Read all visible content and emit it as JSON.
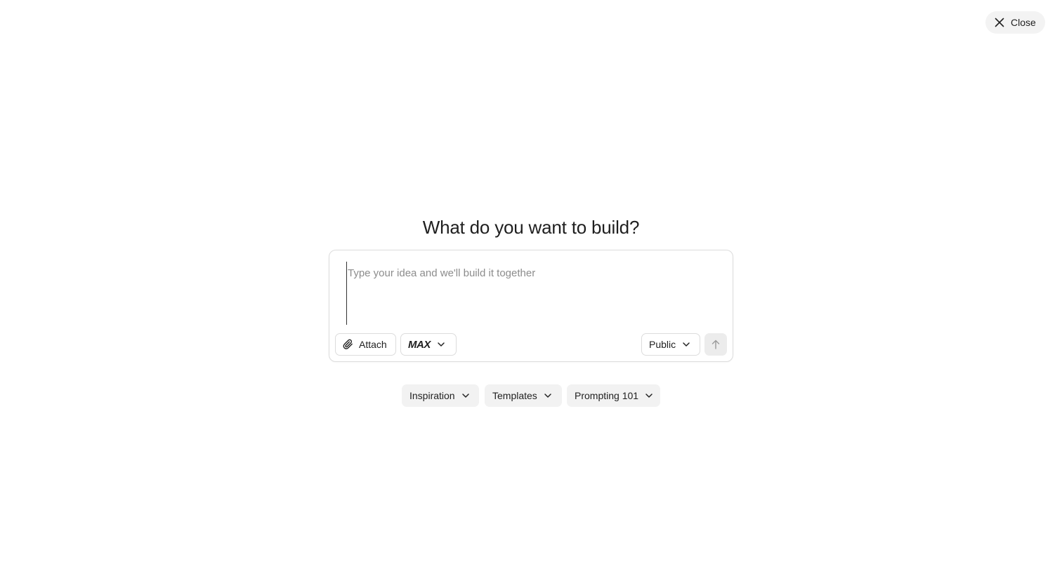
{
  "close_button": {
    "label": "Close",
    "icon": "close-icon"
  },
  "heading": "What do you want to build?",
  "composer": {
    "placeholder": "Type your idea and we'll build it together",
    "value": "",
    "attach": {
      "label": "Attach",
      "icon": "paperclip-icon"
    },
    "model": {
      "selected": "MAX",
      "icon": "chevron-down-icon"
    },
    "visibility": {
      "selected": "Public",
      "icon": "chevron-down-icon"
    },
    "send": {
      "icon": "arrow-up-icon"
    }
  },
  "quick_links": [
    {
      "label": "Inspiration",
      "icon": "chevron-down-icon"
    },
    {
      "label": "Templates",
      "icon": "chevron-down-icon"
    },
    {
      "label": "Prompting 101",
      "icon": "chevron-down-icon"
    }
  ],
  "colors": {
    "background": "#ffffff",
    "pill_background": "#f2f2f2",
    "border": "#dcdcdc",
    "text": "#1f1f1f",
    "placeholder": "#8c8c8c",
    "send_disabled": "#ececec"
  }
}
